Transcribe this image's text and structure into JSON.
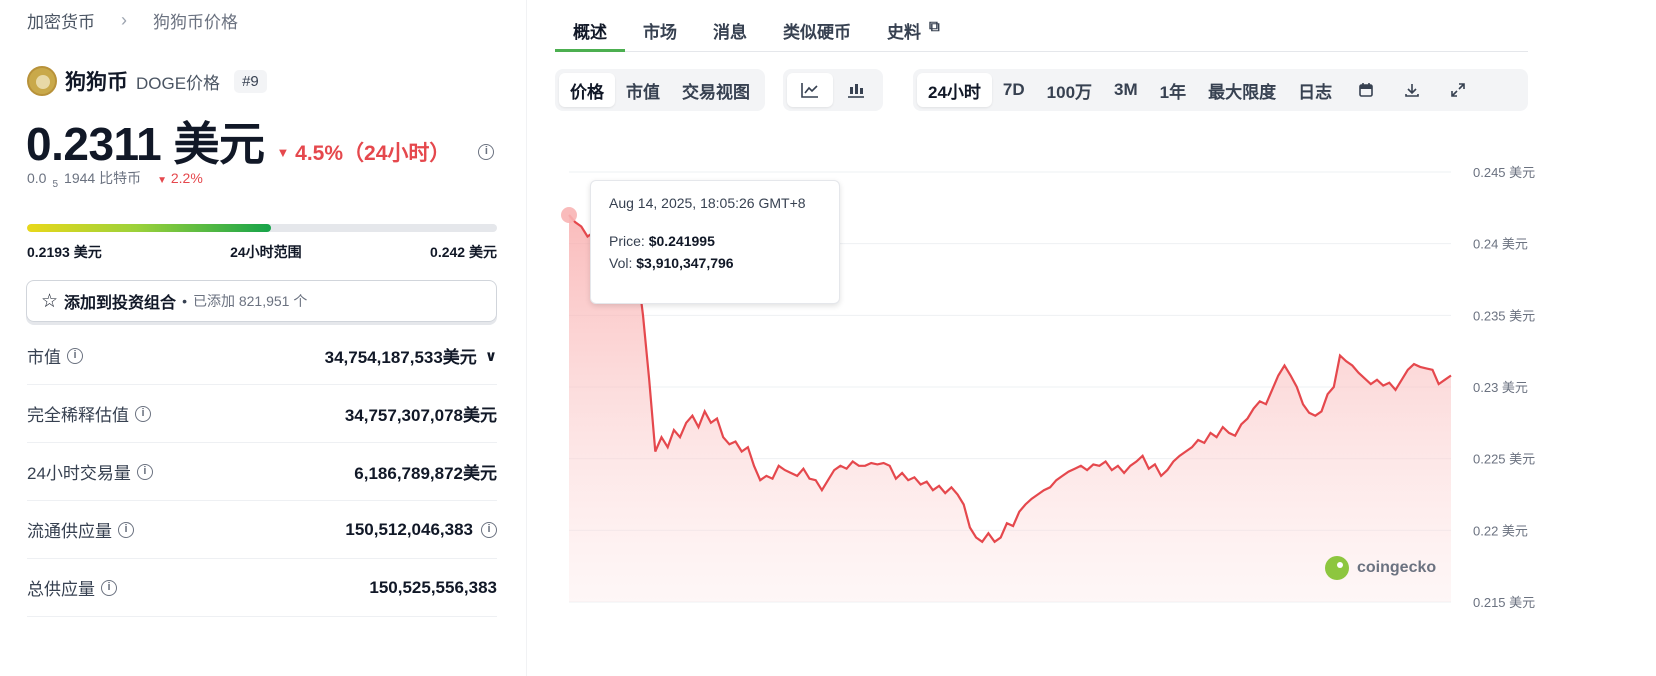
{
  "breadcrumb": {
    "root": "加密货币",
    "separator": "›",
    "current": "狗狗币价格"
  },
  "coin": {
    "name": "狗狗币",
    "subtitle": "DOGE价格",
    "rank": "#9",
    "logo_icon": "dogecoin-logo"
  },
  "price": {
    "value": "0.2311 美元",
    "change": "4.5%（24小时）",
    "direction": "down",
    "change_color": "#e5484d"
  },
  "btc": {
    "prefix": "0.0",
    "subscript": "5",
    "value": "1944 比特币",
    "change": "2.2%"
  },
  "range": {
    "low": "0.2193 美元",
    "label": "24小时范围",
    "high": "0.242 美元",
    "fill_fraction": 0.52
  },
  "portfolio": {
    "label": "添加到投资组合",
    "added": "已添加 821,951 个"
  },
  "stats": [
    {
      "key": "市值",
      "value": "34,754,187,533美元",
      "has_chevron": true,
      "value_info": false
    },
    {
      "key": "完全稀释估值",
      "value": "34,757,307,078美元",
      "has_chevron": false,
      "value_info": false
    },
    {
      "key": "24小时交易量",
      "value": "6,186,789,872美元",
      "has_chevron": false,
      "value_info": false
    },
    {
      "key": "流通供应量",
      "value": "150,512,046,383",
      "has_chevron": false,
      "value_info": true
    },
    {
      "key": "总供应量",
      "value": "150,525,556,383",
      "has_chevron": false,
      "value_info": false
    }
  ],
  "tabs": [
    "概述",
    "市场",
    "消息",
    "类似硬币",
    "史料"
  ],
  "chart_toolbar": {
    "modes": [
      "价格",
      "市值",
      "交易视图"
    ],
    "views": [
      "line-chart-icon",
      "candlestick-icon"
    ],
    "ranges": [
      "24小时",
      "7D",
      "100万",
      "3M",
      "1年",
      "最大限度",
      "日志"
    ],
    "tools": [
      "calendar-icon",
      "download-icon",
      "fullscreen-icon"
    ]
  },
  "tooltip": {
    "date": "Aug 14, 2025, 18:05:26 GMT+8",
    "price_label": "Price:",
    "price": "$0.241995",
    "vol_label": "Vol:",
    "vol": "$3,910,347,796"
  },
  "watermark": "coingecko",
  "chart_data": {
    "type": "area",
    "ylim": [
      0.215,
      0.245
    ],
    "y_ticks": [
      "0.245 美元",
      "0.24 美元",
      "0.235 美元",
      "0.23 美元",
      "0.225 美元",
      "0.22 美元",
      "0.215 美元"
    ],
    "y_tick_values": [
      0.245,
      0.24,
      0.235,
      0.23,
      0.225,
      0.22,
      0.215
    ],
    "line_color": "#e5484d",
    "values": [
      0.242,
      0.2415,
      0.2412,
      0.2405,
      0.2408,
      0.24,
      0.2395,
      0.24,
      0.2398,
      0.2388,
      0.2395,
      0.2385,
      0.235,
      0.2305,
      0.2255,
      0.2265,
      0.2258,
      0.227,
      0.2265,
      0.2275,
      0.228,
      0.2272,
      0.2283,
      0.2275,
      0.2278,
      0.2265,
      0.226,
      0.2262,
      0.2255,
      0.2258,
      0.2245,
      0.2235,
      0.2238,
      0.2236,
      0.2245,
      0.2242,
      0.224,
      0.2238,
      0.2243,
      0.2236,
      0.2235,
      0.2228,
      0.2235,
      0.2242,
      0.2245,
      0.2243,
      0.2248,
      0.2245,
      0.2245,
      0.2247,
      0.2246,
      0.2247,
      0.2245,
      0.2236,
      0.224,
      0.2235,
      0.2237,
      0.2232,
      0.2234,
      0.2228,
      0.2231,
      0.2226,
      0.223,
      0.2225,
      0.2218,
      0.2202,
      0.2195,
      0.2192,
      0.2198,
      0.2192,
      0.2195,
      0.2205,
      0.2203,
      0.2213,
      0.2218,
      0.2222,
      0.2225,
      0.2228,
      0.223,
      0.2235,
      0.2238,
      0.2241,
      0.2243,
      0.2245,
      0.2242,
      0.2246,
      0.2245,
      0.2248,
      0.2242,
      0.2245,
      0.224,
      0.2245,
      0.2248,
      0.2252,
      0.2243,
      0.2246,
      0.2238,
      0.2242,
      0.2248,
      0.2252,
      0.2255,
      0.2258,
      0.2263,
      0.2261,
      0.2268,
      0.2265,
      0.2272,
      0.2268,
      0.2266,
      0.2274,
      0.2278,
      0.2285,
      0.229,
      0.2288,
      0.2298,
      0.2308,
      0.2315,
      0.2308,
      0.23,
      0.2288,
      0.2282,
      0.228,
      0.2283,
      0.2295,
      0.23,
      0.2322,
      0.2318,
      0.2315,
      0.231,
      0.2306,
      0.2302,
      0.2305,
      0.2301,
      0.2303,
      0.2298,
      0.2305,
      0.2312,
      0.2316,
      0.2314,
      0.2313,
      0.2312,
      0.2302,
      0.2305,
      0.2308
    ]
  }
}
